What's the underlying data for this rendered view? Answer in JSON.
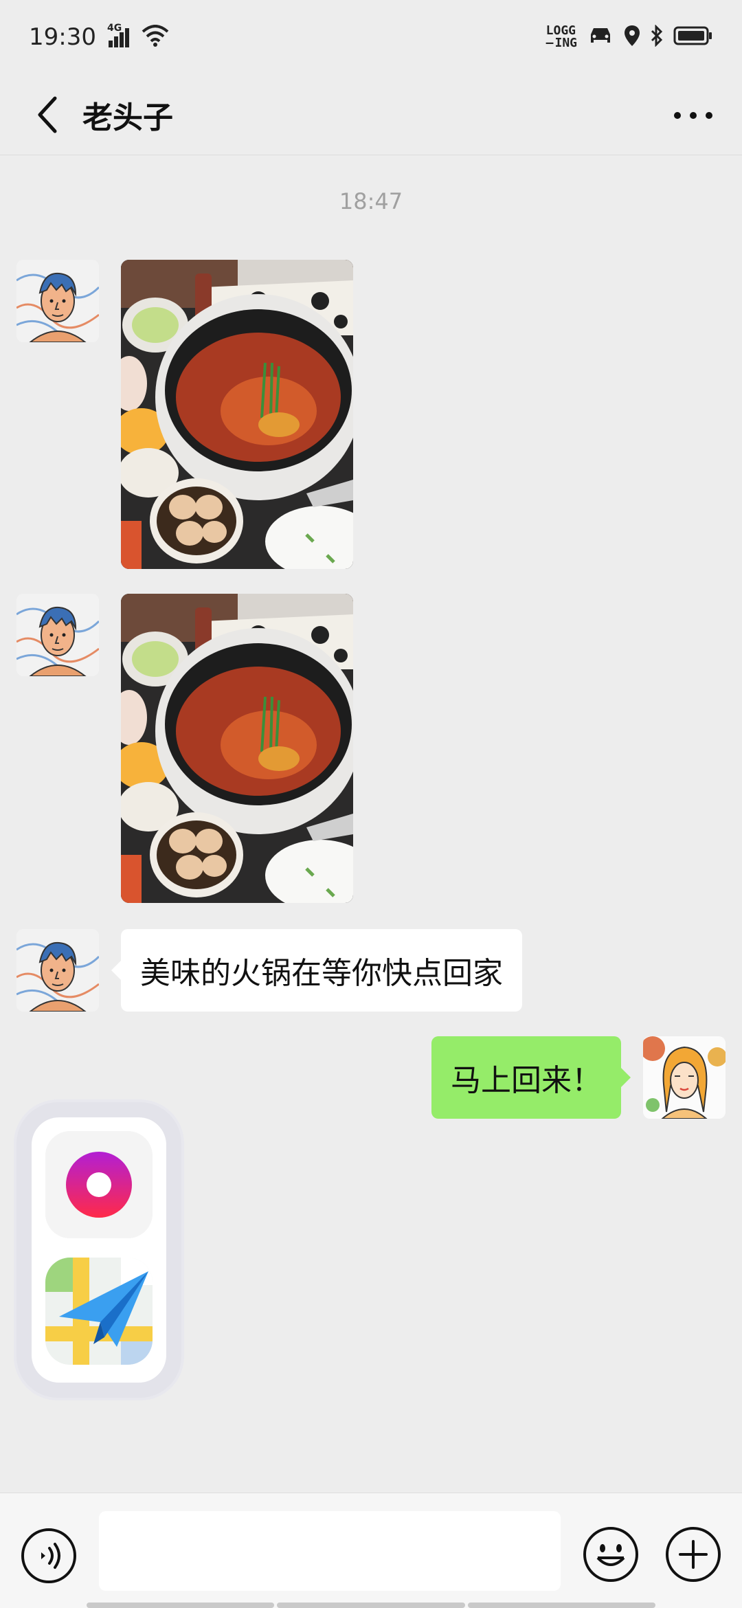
{
  "status_bar": {
    "time": "19:30",
    "network": "4G",
    "logging_line1": "LOGG",
    "logging_line2": "ING",
    "icons": [
      "signal-icon",
      "wifi-icon",
      "car-icon",
      "location-icon",
      "bluetooth-icon",
      "battery-icon"
    ]
  },
  "header": {
    "title": "老头子",
    "back_icon": "chevron-left-icon",
    "more_icon": "more-dots-icon"
  },
  "chat": {
    "timestamp": "18:47",
    "messages": [
      {
        "side": "left",
        "type": "image",
        "content": "hotpot-photo"
      },
      {
        "side": "left",
        "type": "image",
        "content": "hotpot-photo"
      },
      {
        "side": "left",
        "type": "text",
        "text": "美味的火锅在等你快点回家"
      },
      {
        "side": "right",
        "type": "text",
        "text": "马上回来！"
      }
    ]
  },
  "app_dock": {
    "apps": [
      "donut-app-icon",
      "paper-plane-map-icon"
    ]
  },
  "input_bar": {
    "placeholder": "",
    "voice_icon": "voice-icon",
    "emoji_icon": "emoji-icon",
    "plus_icon": "plus-icon"
  },
  "colors": {
    "background": "#ededed",
    "bubble_right": "#95ec69",
    "bubble_left": "#ffffff",
    "timestamp": "#a0a0a0"
  }
}
